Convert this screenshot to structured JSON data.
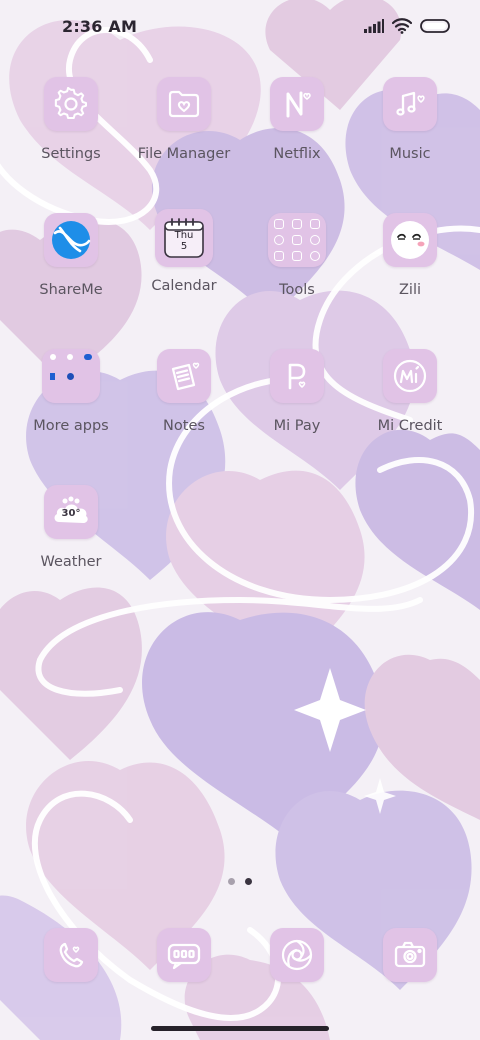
{
  "status_bar": {
    "time": "2:36 AM"
  },
  "apps": [
    {
      "label": "Settings",
      "icon": "gear-icon"
    },
    {
      "label": "File Manager",
      "icon": "folder-heart-icon"
    },
    {
      "label": "Netflix",
      "icon": "netflix-n-icon"
    },
    {
      "label": "Music",
      "icon": "music-note-icon"
    },
    {
      "label": "ShareMe",
      "icon": "shareme-icon"
    },
    {
      "label": "Calendar",
      "icon": "calendar-icon",
      "day": "Thu",
      "date": "5"
    },
    {
      "label": "Tools",
      "icon": "tools-folder-icon"
    },
    {
      "label": "Zili",
      "icon": "zili-face-icon"
    },
    {
      "label": "More apps",
      "icon": "more-apps-folder-icon"
    },
    {
      "label": "Notes",
      "icon": "notes-icon"
    },
    {
      "label": "Mi Pay",
      "icon": "mi-pay-icon"
    },
    {
      "label": "Mi Credit",
      "icon": "mi-credit-icon"
    },
    {
      "label": "Weather",
      "icon": "weather-icon",
      "temperature": "30°"
    }
  ],
  "dock": [
    {
      "icon": "phone-icon"
    },
    {
      "icon": "messages-icon"
    },
    {
      "icon": "browser-icon"
    },
    {
      "icon": "camera-icon"
    }
  ],
  "page_indicator": {
    "pages": 2,
    "current": 2
  },
  "colors": {
    "tile": "#e1c3e6",
    "accent_blue": "#1e8ee8",
    "wallpaper_purple": "#c8b8e2",
    "wallpaper_pink": "#e4cbe0"
  }
}
